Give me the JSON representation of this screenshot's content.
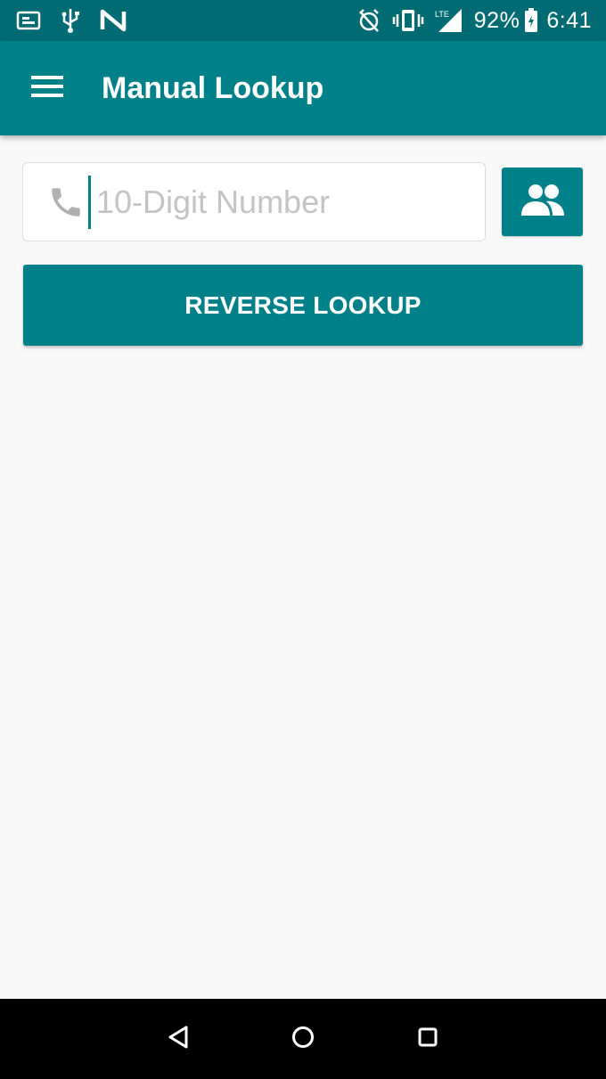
{
  "status_bar": {
    "icons_left": [
      "sim-card-icon",
      "usb-icon",
      "nfc-icon"
    ],
    "icons_right": [
      "alarm-off-icon",
      "vibrate-icon",
      "signal-icon",
      "battery-icon"
    ],
    "network_label": "LTE",
    "battery_percent": "92%",
    "time": "6:41"
  },
  "app_bar": {
    "title": "Manual Lookup",
    "menu_icon": "hamburger-menu-icon"
  },
  "lookup": {
    "phone_placeholder": "10-Digit Number",
    "phone_value": "",
    "phone_icon": "phone-icon",
    "contacts_icon": "contacts-icon",
    "reverse_lookup_label": "REVERSE LOOKUP"
  },
  "nav_bar": {
    "back_icon": "back-triangle-icon",
    "home_icon": "home-circle-icon",
    "recents_icon": "recents-square-icon"
  },
  "colors": {
    "primary": "#008089",
    "status_bar": "#006b73",
    "background": "#f9f9f9",
    "placeholder": "#c4c4c4"
  }
}
